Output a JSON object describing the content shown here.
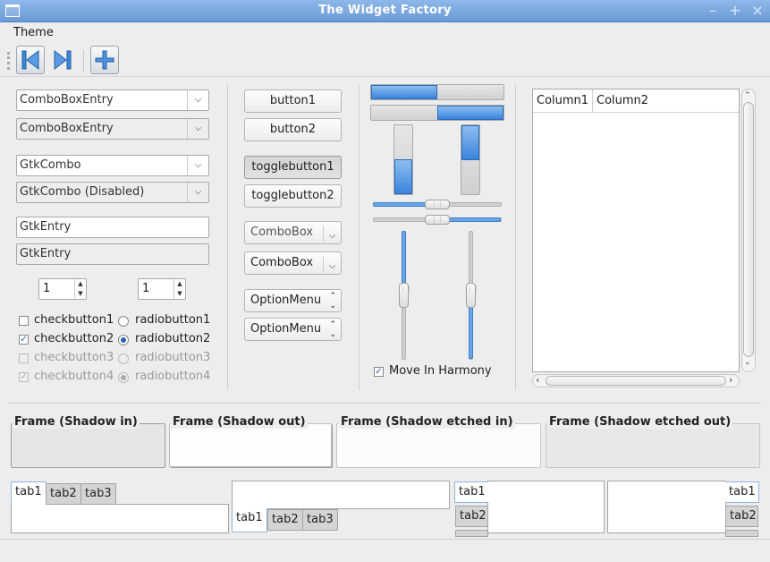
{
  "window": {
    "title": "The Widget Factory"
  },
  "menubar": {
    "items": [
      "Theme"
    ]
  },
  "toolbar": {
    "buttons": [
      {
        "icon": "go-first-icon",
        "active": true
      },
      {
        "icon": "go-last-icon",
        "active": false
      },
      {
        "icon": "add-icon",
        "active": true
      }
    ]
  },
  "left": {
    "combo_entries": [
      "ComboBoxEntry",
      "ComboBoxEntry"
    ],
    "gtk_combos": [
      "GtkCombo",
      "GtkCombo (Disabled)"
    ],
    "entries": [
      "GtkEntry",
      "GtkEntry"
    ],
    "spins": [
      "1",
      "1"
    ],
    "checks": [
      {
        "label": "checkbutton1",
        "checked": false,
        "disabled": false
      },
      {
        "label": "checkbutton2",
        "checked": true,
        "disabled": false
      },
      {
        "label": "checkbutton3",
        "checked": false,
        "disabled": true
      },
      {
        "label": "checkbutton4",
        "checked": true,
        "disabled": true
      }
    ],
    "radios": [
      {
        "label": "radiobutton1",
        "selected": false,
        "disabled": false
      },
      {
        "label": "radiobutton2",
        "selected": true,
        "disabled": false
      },
      {
        "label": "radiobutton3",
        "selected": false,
        "disabled": true
      },
      {
        "label": "radiobutton4",
        "selected": true,
        "disabled": true
      }
    ]
  },
  "middle": {
    "buttons": [
      "button1",
      "button2"
    ],
    "toggles": [
      "togglebutton1",
      "togglebutton2"
    ],
    "comboboxes": [
      "ComboBox",
      "ComboBox"
    ],
    "optionmenus": [
      "OptionMenu",
      "OptionMenu"
    ]
  },
  "progress": {
    "horizontal": [
      0.5,
      0.5
    ],
    "vertical": [
      0.5,
      0.5
    ]
  },
  "scales": {
    "horizontal": [
      0.5,
      0.5
    ],
    "vertical": [
      0.5,
      0.5
    ],
    "move_in_harmony": {
      "label": "Move In Harmony",
      "checked": true
    }
  },
  "tree": {
    "columns": [
      "Column1",
      "Column2"
    ]
  },
  "frames": [
    "Frame (Shadow in)",
    "Frame (Shadow out)",
    "Frame (Shadow etched in)",
    "Frame (Shadow etched out)"
  ],
  "notebooks": {
    "tabs": [
      "tab1",
      "tab2",
      "tab3"
    ]
  },
  "colors": {
    "accent": "#3a85dc",
    "titlebar": "#7aa7e0"
  }
}
